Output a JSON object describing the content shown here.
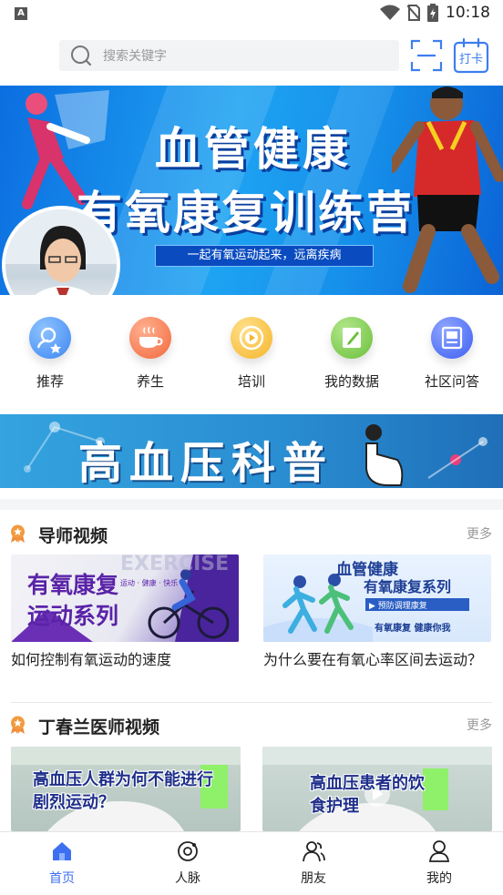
{
  "status_bar": {
    "time": "10:18",
    "app_badge": "A"
  },
  "header": {
    "search_placeholder": "搜索关键字",
    "checkin_label": "打卡"
  },
  "banner": {
    "title_line1": "血管健康",
    "title_line2": "有氧康复训练营",
    "subtitle": "一起有氧运动起来，远离疾病"
  },
  "quick_nav": [
    {
      "label": "推荐",
      "icon": "recommend-icon",
      "color": "#3d86f2"
    },
    {
      "label": "养生",
      "icon": "tea-cup-icon",
      "color": "#f2683d"
    },
    {
      "label": "培训",
      "icon": "play-circle-icon",
      "color": "#f5b52a"
    },
    {
      "label": "我的数据",
      "icon": "edit-data-icon",
      "color": "#6bbf3a"
    },
    {
      "label": "社区问答",
      "icon": "qa-board-icon",
      "color": "#3d5ff2"
    }
  ],
  "promo_banner": {
    "text": "高血压科普"
  },
  "sections": [
    {
      "title": "导师视频",
      "more": "更多",
      "videos": [
        {
          "title": "如何控制有氧运动的速度",
          "thumb_line1": "有氧康复",
          "thumb_line2": "运动系列",
          "thumb_watermark": "EXERCISE",
          "thumb_tagline": "运动 · 健康 · 快乐"
        },
        {
          "title": "为什么要在有氧心率区间去运动？",
          "thumb_line1": "血管健康",
          "thumb_line2": "有氧康复系列",
          "thumb_tag": "▶ 预防调理康复",
          "thumb_foot": "有氧康复  健康你我"
        }
      ]
    },
    {
      "title": "丁春兰医师视频",
      "more": "更多",
      "videos": [
        {
          "thumb_caption": "高血压人群为何不能进行剧烈运动？"
        },
        {
          "thumb_caption": "高血压患者的饮食护理"
        }
      ]
    }
  ],
  "bottom_nav": [
    {
      "label": "首页",
      "icon": "home-icon",
      "active": true
    },
    {
      "label": "人脉",
      "icon": "connections-icon",
      "active": false
    },
    {
      "label": "朋友",
      "icon": "friends-icon",
      "active": false
    },
    {
      "label": "我的",
      "icon": "profile-icon",
      "active": false
    }
  ],
  "colors": {
    "accent": "#3d6ff0",
    "banner_blue": "#1690ea"
  }
}
